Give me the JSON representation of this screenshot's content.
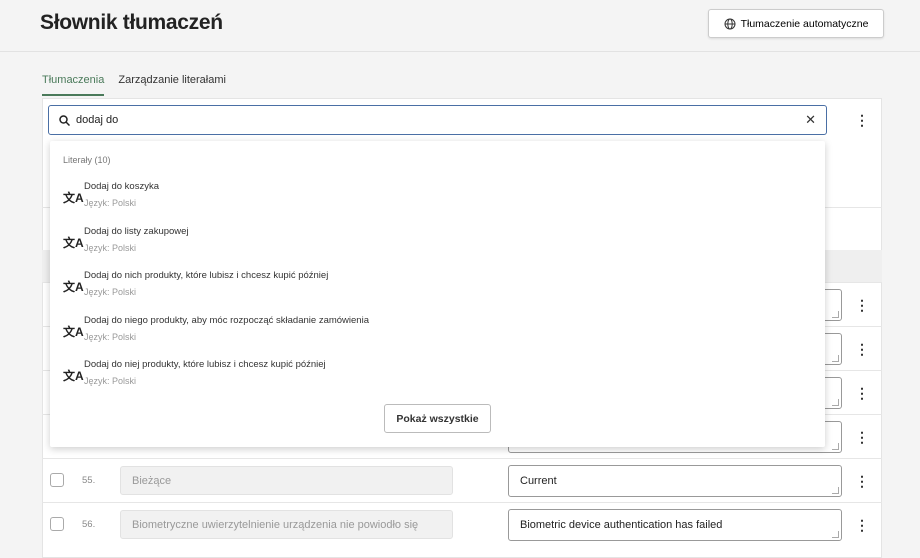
{
  "header": {
    "title": "Słownik tłumaczeń",
    "auto_translate_label": "Tłumaczenie automatyczne"
  },
  "tabs": [
    {
      "label": "Tłumaczenia",
      "active": true
    },
    {
      "label": "Zarządzanie literałami",
      "active": false
    }
  ],
  "search": {
    "value": "dodaj do"
  },
  "dropdown": {
    "heading": "Literały (10)",
    "items": [
      {
        "label": "Dodaj do koszyka",
        "language": "Język: Polski"
      },
      {
        "label": "Dodaj do listy zakupowej",
        "language": "Język: Polski"
      },
      {
        "label": "Dodaj do nich produkty, które lubisz i chcesz kupić później",
        "language": "Język: Polski"
      },
      {
        "label": "Dodaj do niego produkty, aby móc rozpocząć składanie zamówienia",
        "language": "Język: Polski"
      },
      {
        "label": "Dodaj do niej produkty, które lubisz i chcesz kupić później",
        "language": "Język: Polski"
      }
    ],
    "show_all_label": "Pokaż wszystkie"
  },
  "rows": [
    {
      "number": "55.",
      "source": "Bieżące",
      "target": "Current"
    },
    {
      "number": "56.",
      "source": "Biometryczne uwierzytelnienie urządzenia nie powiodło się",
      "target": "Biometric device authentication has failed"
    }
  ],
  "colors": {
    "accent": "#4a7a5a",
    "focus": "#4a6fa5"
  }
}
